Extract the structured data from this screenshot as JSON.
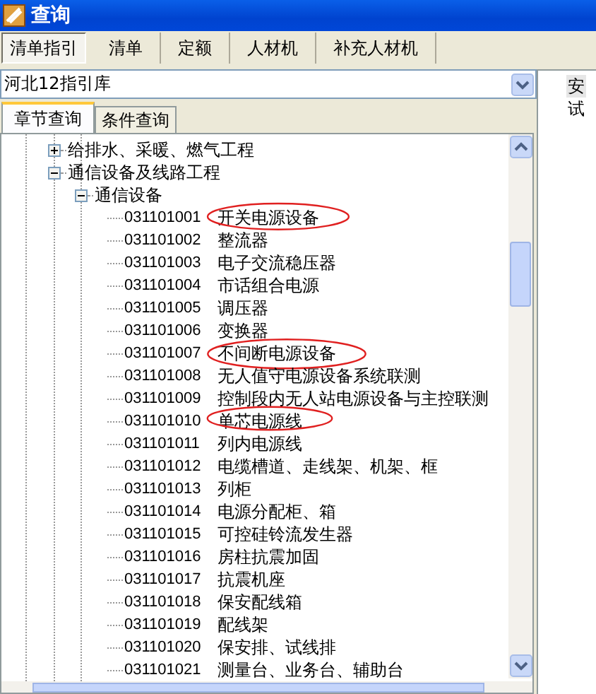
{
  "window": {
    "title": "查询"
  },
  "tabs": [
    {
      "label": "清单指引",
      "selected": true
    },
    {
      "label": "清单",
      "selected": false
    },
    {
      "label": "定额",
      "selected": false
    },
    {
      "label": "人材机",
      "selected": false
    },
    {
      "label": "补充人材机",
      "selected": false
    }
  ],
  "library_select": {
    "value": "河北12指引库"
  },
  "query_tabs": [
    {
      "label": "章节查询",
      "selected": true
    },
    {
      "label": "条件查询",
      "selected": false
    }
  ],
  "tree": [
    {
      "label": "给排水、采暖、燃气工程",
      "expanded": false
    },
    {
      "label": "通信设备及线路工程",
      "expanded": true,
      "children": [
        {
          "label": "通信设备",
          "expanded": true,
          "children": [
            {
              "code": "031101001",
              "label": "开关电源设备",
              "circled": true
            },
            {
              "code": "031101002",
              "label": "整流器",
              "circled": false
            },
            {
              "code": "031101003",
              "label": "电子交流稳压器",
              "circled": false
            },
            {
              "code": "031101004",
              "label": "市话组合电源",
              "circled": false
            },
            {
              "code": "031101005",
              "label": "调压器",
              "circled": false
            },
            {
              "code": "031101006",
              "label": "变换器",
              "circled": false
            },
            {
              "code": "031101007",
              "label": "不间断电源设备",
              "circled": true
            },
            {
              "code": "031101008",
              "label": "无人值守电源设备系统联测",
              "circled": false
            },
            {
              "code": "031101009",
              "label": "控制段内无人站电源设备与主控联测",
              "circled": false
            },
            {
              "code": "031101010",
              "label": "单芯电源线",
              "circled": true
            },
            {
              "code": "031101011",
              "label": "列内电源线",
              "circled": false
            },
            {
              "code": "031101012",
              "label": "电缆槽道、走线架、机架、框",
              "circled": false
            },
            {
              "code": "031101013",
              "label": "列柜",
              "circled": false
            },
            {
              "code": "031101014",
              "label": "电源分配柜、箱",
              "circled": false
            },
            {
              "code": "031101015",
              "label": "可控硅铃流发生器",
              "circled": false
            },
            {
              "code": "031101016",
              "label": "房柱抗震加固",
              "circled": false
            },
            {
              "code": "031101017",
              "label": "抗震机座",
              "circled": false
            },
            {
              "code": "031101018",
              "label": "保安配线箱",
              "circled": false
            },
            {
              "code": "031101019",
              "label": "配线架",
              "circled": false
            },
            {
              "code": "031101020",
              "label": "保安排、试线排",
              "circled": false
            },
            {
              "code": "031101021",
              "label": "测量台、业务台、辅助台",
              "circled": false
            }
          ]
        }
      ]
    }
  ],
  "right_panel": {
    "items": [
      {
        "label": "安",
        "selected": true
      },
      {
        "label": "试",
        "selected": false
      }
    ]
  }
}
